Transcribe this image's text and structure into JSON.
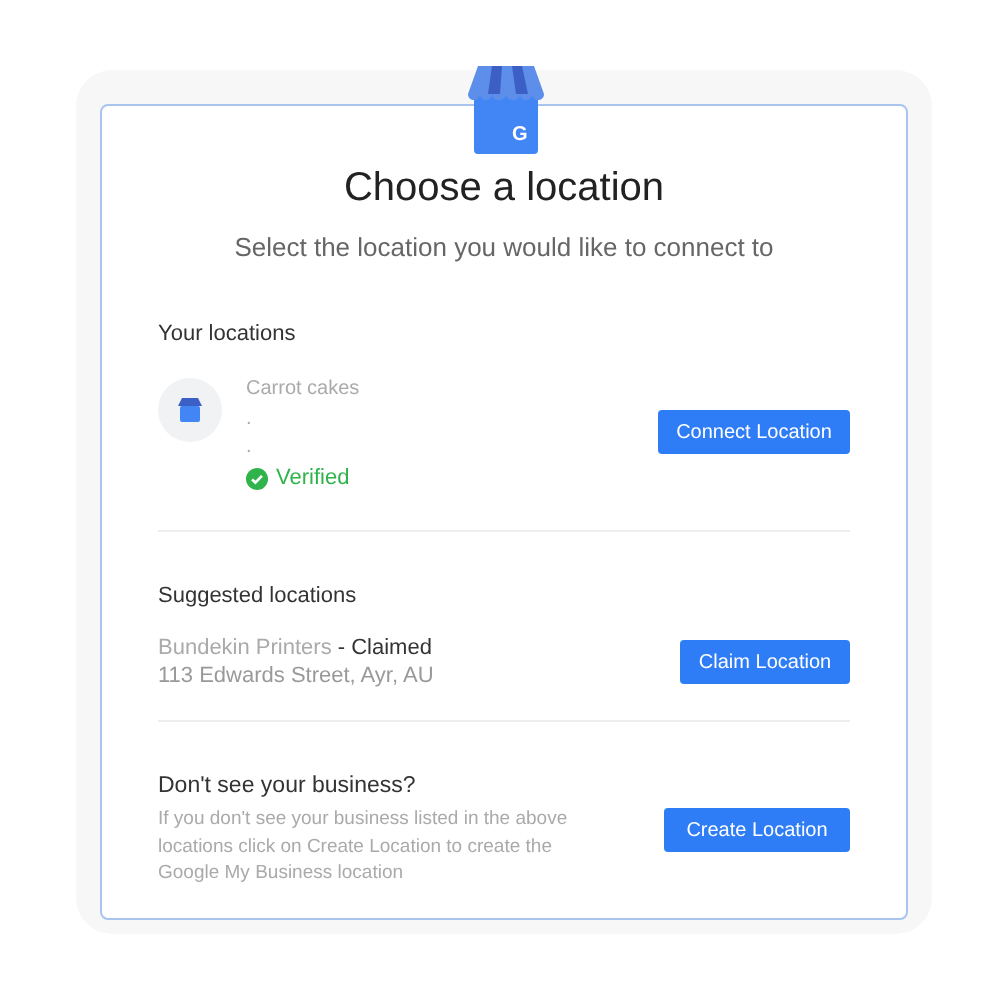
{
  "logo": {
    "letter": "G"
  },
  "title": "Choose a location",
  "subtitle": "Select the location you would like to connect to",
  "your_locations": {
    "heading": "Your locations",
    "items": [
      {
        "name": "Carrot cakes",
        "address_lines": [
          ".",
          "."
        ],
        "verified": true,
        "status": "Verified",
        "button": "Connect Location"
      }
    ]
  },
  "suggested_locations": {
    "heading": "Suggested locations",
    "items": [
      {
        "name": "Bundekin Printers",
        "claim_status": " - Claimed",
        "address": "113 Edwards Street, Ayr, AU",
        "button": "Claim Location"
      }
    ]
  },
  "create": {
    "heading": "Don't see your business?",
    "text": "If you don't see your business listed in the above locations click on Create Location to create the Google My Business location",
    "button": "Create Location"
  }
}
